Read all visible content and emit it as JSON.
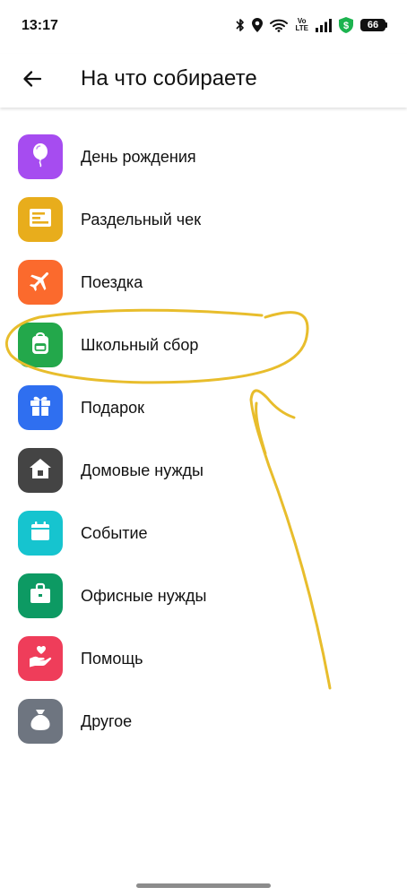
{
  "status_bar": {
    "time": "13:17",
    "volte_top": "Vo",
    "volte_bottom": "LTE",
    "battery": "66"
  },
  "app_bar": {
    "title": "На что собираете",
    "back_icon": "arrow-left-icon"
  },
  "categories": [
    {
      "label": "День рождения",
      "icon": "balloon-icon",
      "color": "#a64cf0"
    },
    {
      "label": "Раздельный чек",
      "icon": "receipt-icon",
      "color": "#e8ad1c"
    },
    {
      "label": "Поездка",
      "icon": "airplane-icon",
      "color": "#fb6a2d"
    },
    {
      "label": "Школьный сбор",
      "icon": "backpack-icon",
      "color": "#23a84b"
    },
    {
      "label": "Подарок",
      "icon": "gift-icon",
      "color": "#2f6ff0"
    },
    {
      "label": "Домовые нужды",
      "icon": "house-icon",
      "color": "#444444"
    },
    {
      "label": "Событие",
      "icon": "calendar-icon",
      "color": "#16c4cf"
    },
    {
      "label": "Офисные нужды",
      "icon": "briefcase-icon",
      "color": "#0d9a63"
    },
    {
      "label": "Помощь",
      "icon": "heart-hand-icon",
      "color": "#ef3d5a"
    },
    {
      "label": "Другое",
      "icon": "money-bag-icon",
      "color": "#6e7580"
    }
  ],
  "annotation_color": "#e8bd2c"
}
